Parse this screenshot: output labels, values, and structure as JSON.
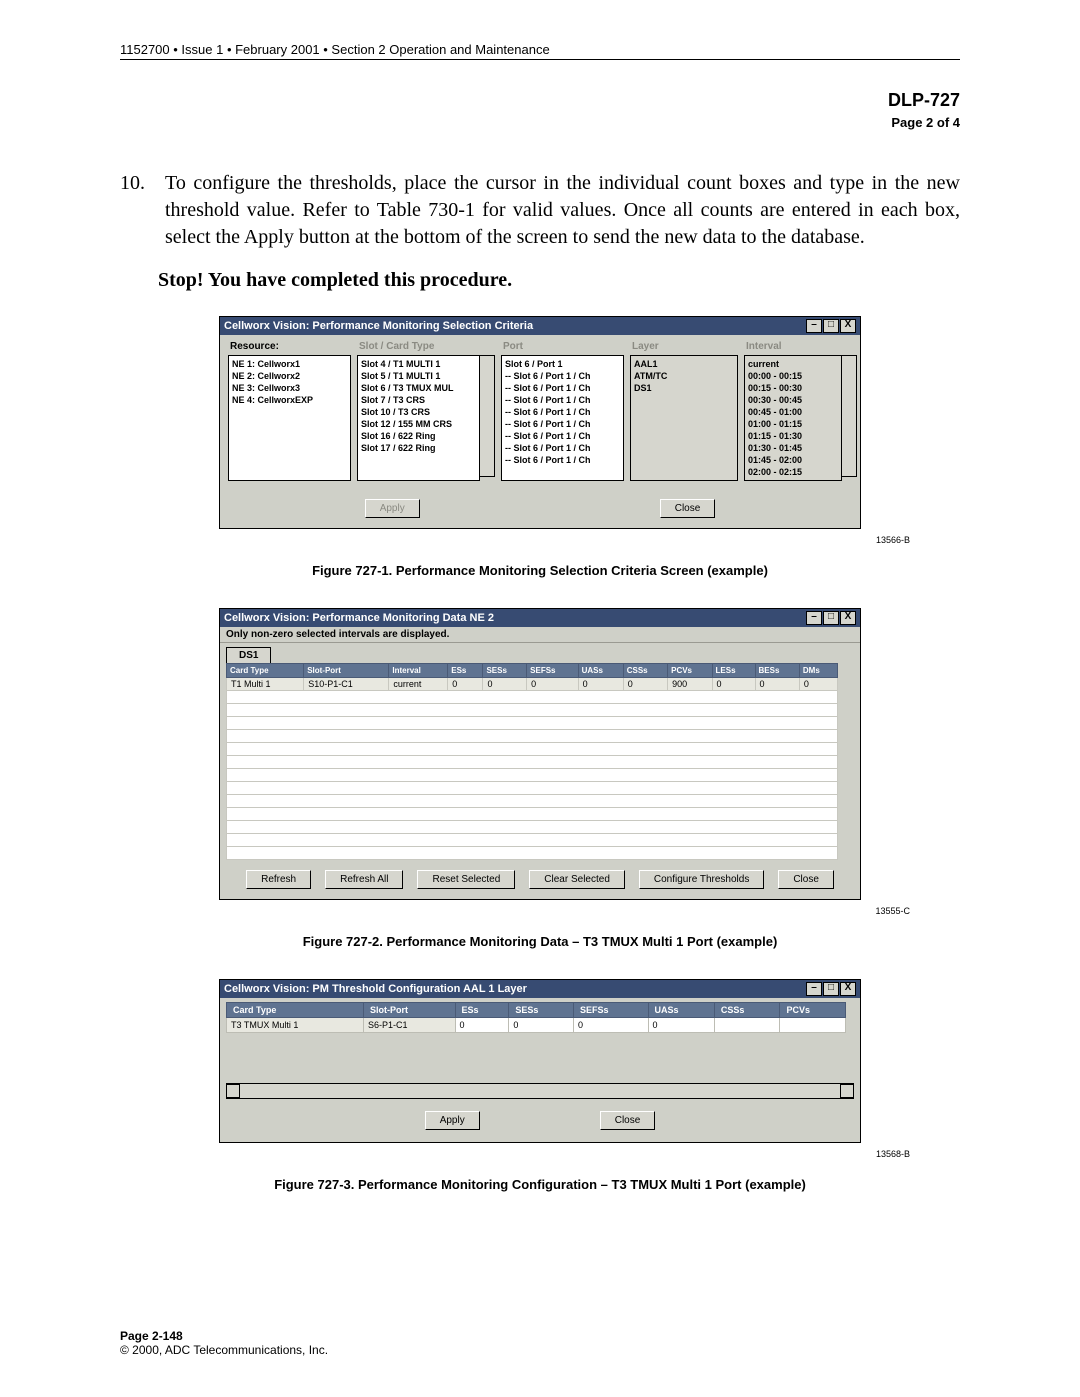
{
  "header": "1152700 • Issue 1 • February 2001 • Section 2 Operation and Maintenance",
  "dlp": "DLP-727",
  "pageof": "Page 2 of 4",
  "step_num": "10.",
  "step_text": "To configure the thresholds, place the cursor in the individual count boxes and type in the new threshold value. Refer to Table 730-1 for valid values. Once all counts are entered in each box, select the Apply button at the bottom of the screen to send the new data to the database.",
  "stop": "Stop! You have completed this procedure.",
  "fig1": {
    "id": "13566-B",
    "caption": "Figure 727-1.  Performance Monitoring Selection Criteria Screen (example)",
    "title": "Cellworx Vision:   Performance Monitoring Selection Criteria",
    "cols": {
      "resource": {
        "label": "Resource:",
        "items": [
          "NE 1: Cellworx1",
          "NE 2: Cellworx2",
          "NE 3: Cellworx3",
          "NE 4: CellworxEXP"
        ]
      },
      "slot": {
        "label": "Slot / Card Type",
        "items": [
          "Slot 4 / T1 MULTI 1",
          "Slot 5 / T1 MULTI 1",
          "Slot 6 / T3 TMUX MUL",
          "Slot 7 / T3 CRS",
          "Slot 10 / T3 CRS",
          "Slot 12 / 155 MM CRS",
          "Slot 16 / 622 Ring",
          "Slot 17 / 622 Ring"
        ]
      },
      "port": {
        "label": "Port",
        "items": [
          "Slot 6 / Port 1",
          "-- Slot 6 / Port 1 / Ch",
          "-- Slot 6 / Port 1 / Ch",
          "-- Slot 6 / Port 1 / Ch",
          "-- Slot 6 / Port 1 / Ch",
          "-- Slot 6 / Port 1 / Ch",
          "-- Slot 6 / Port 1 / Ch",
          "-- Slot 6 / Port 1 / Ch",
          "-- Slot 6 / Port 1 / Ch"
        ]
      },
      "layer": {
        "label": "Layer",
        "items": [
          "AAL1",
          "ATM/TC",
          "DS1"
        ]
      },
      "interval": {
        "label": "Interval",
        "items": [
          "current",
          "00:00 - 00:15",
          "00:15 - 00:30",
          "00:30 - 00:45",
          "00:45 - 01:00",
          "01:00 - 01:15",
          "01:15 - 01:30",
          "01:30 - 01:45",
          "01:45 - 02:00",
          "02:00 - 02:15"
        ]
      }
    },
    "btn_apply": "Apply",
    "btn_close": "Close"
  },
  "fig2": {
    "id": "13555-C",
    "caption": "Figure 727-2.  Performance Monitoring Data – T3 TMUX Multi 1 Port (example)",
    "title": "Cellworx Vision:   Performance Monitoring Data NE 2",
    "info": "Only non-zero selected intervals are displayed.",
    "tab": "DS1",
    "headers": [
      "Card Type",
      "Slot-Port",
      "Interval",
      "ESs",
      "SESs",
      "SEFSs",
      "UASs",
      "CSSs",
      "PCVs",
      "LESs",
      "BESs",
      "DMs"
    ],
    "row": [
      "T1 Multi 1",
      "S10-P1-C1",
      "current",
      "0",
      "0",
      "0",
      "0",
      "0",
      "900",
      "0",
      "0",
      "0"
    ],
    "btns": [
      "Refresh",
      "Refresh All",
      "Reset Selected",
      "Clear Selected",
      "Configure Thresholds",
      "Close"
    ]
  },
  "fig3": {
    "id": "13568-B",
    "caption": "Figure 727-3.  Performance Monitoring Configuration – T3 TMUX Multi 1 Port (example)",
    "title": "Cellworx Vision:   PM Threshold Configuration AAL 1 Layer",
    "headers": [
      "Card Type",
      "Slot-Port",
      "ESs",
      "SESs",
      "SEFSs",
      "UASs",
      "CSSs",
      "PCVs"
    ],
    "row": [
      "T3 TMUX Multi 1",
      "S6-P1-C1",
      "0",
      "0",
      "0",
      "0",
      "",
      ""
    ],
    "btn_apply": "Apply",
    "btn_close": "Close"
  },
  "footer_page": "Page 2-148",
  "footer_copy": "© 2000, ADC Telecommunications, Inc."
}
